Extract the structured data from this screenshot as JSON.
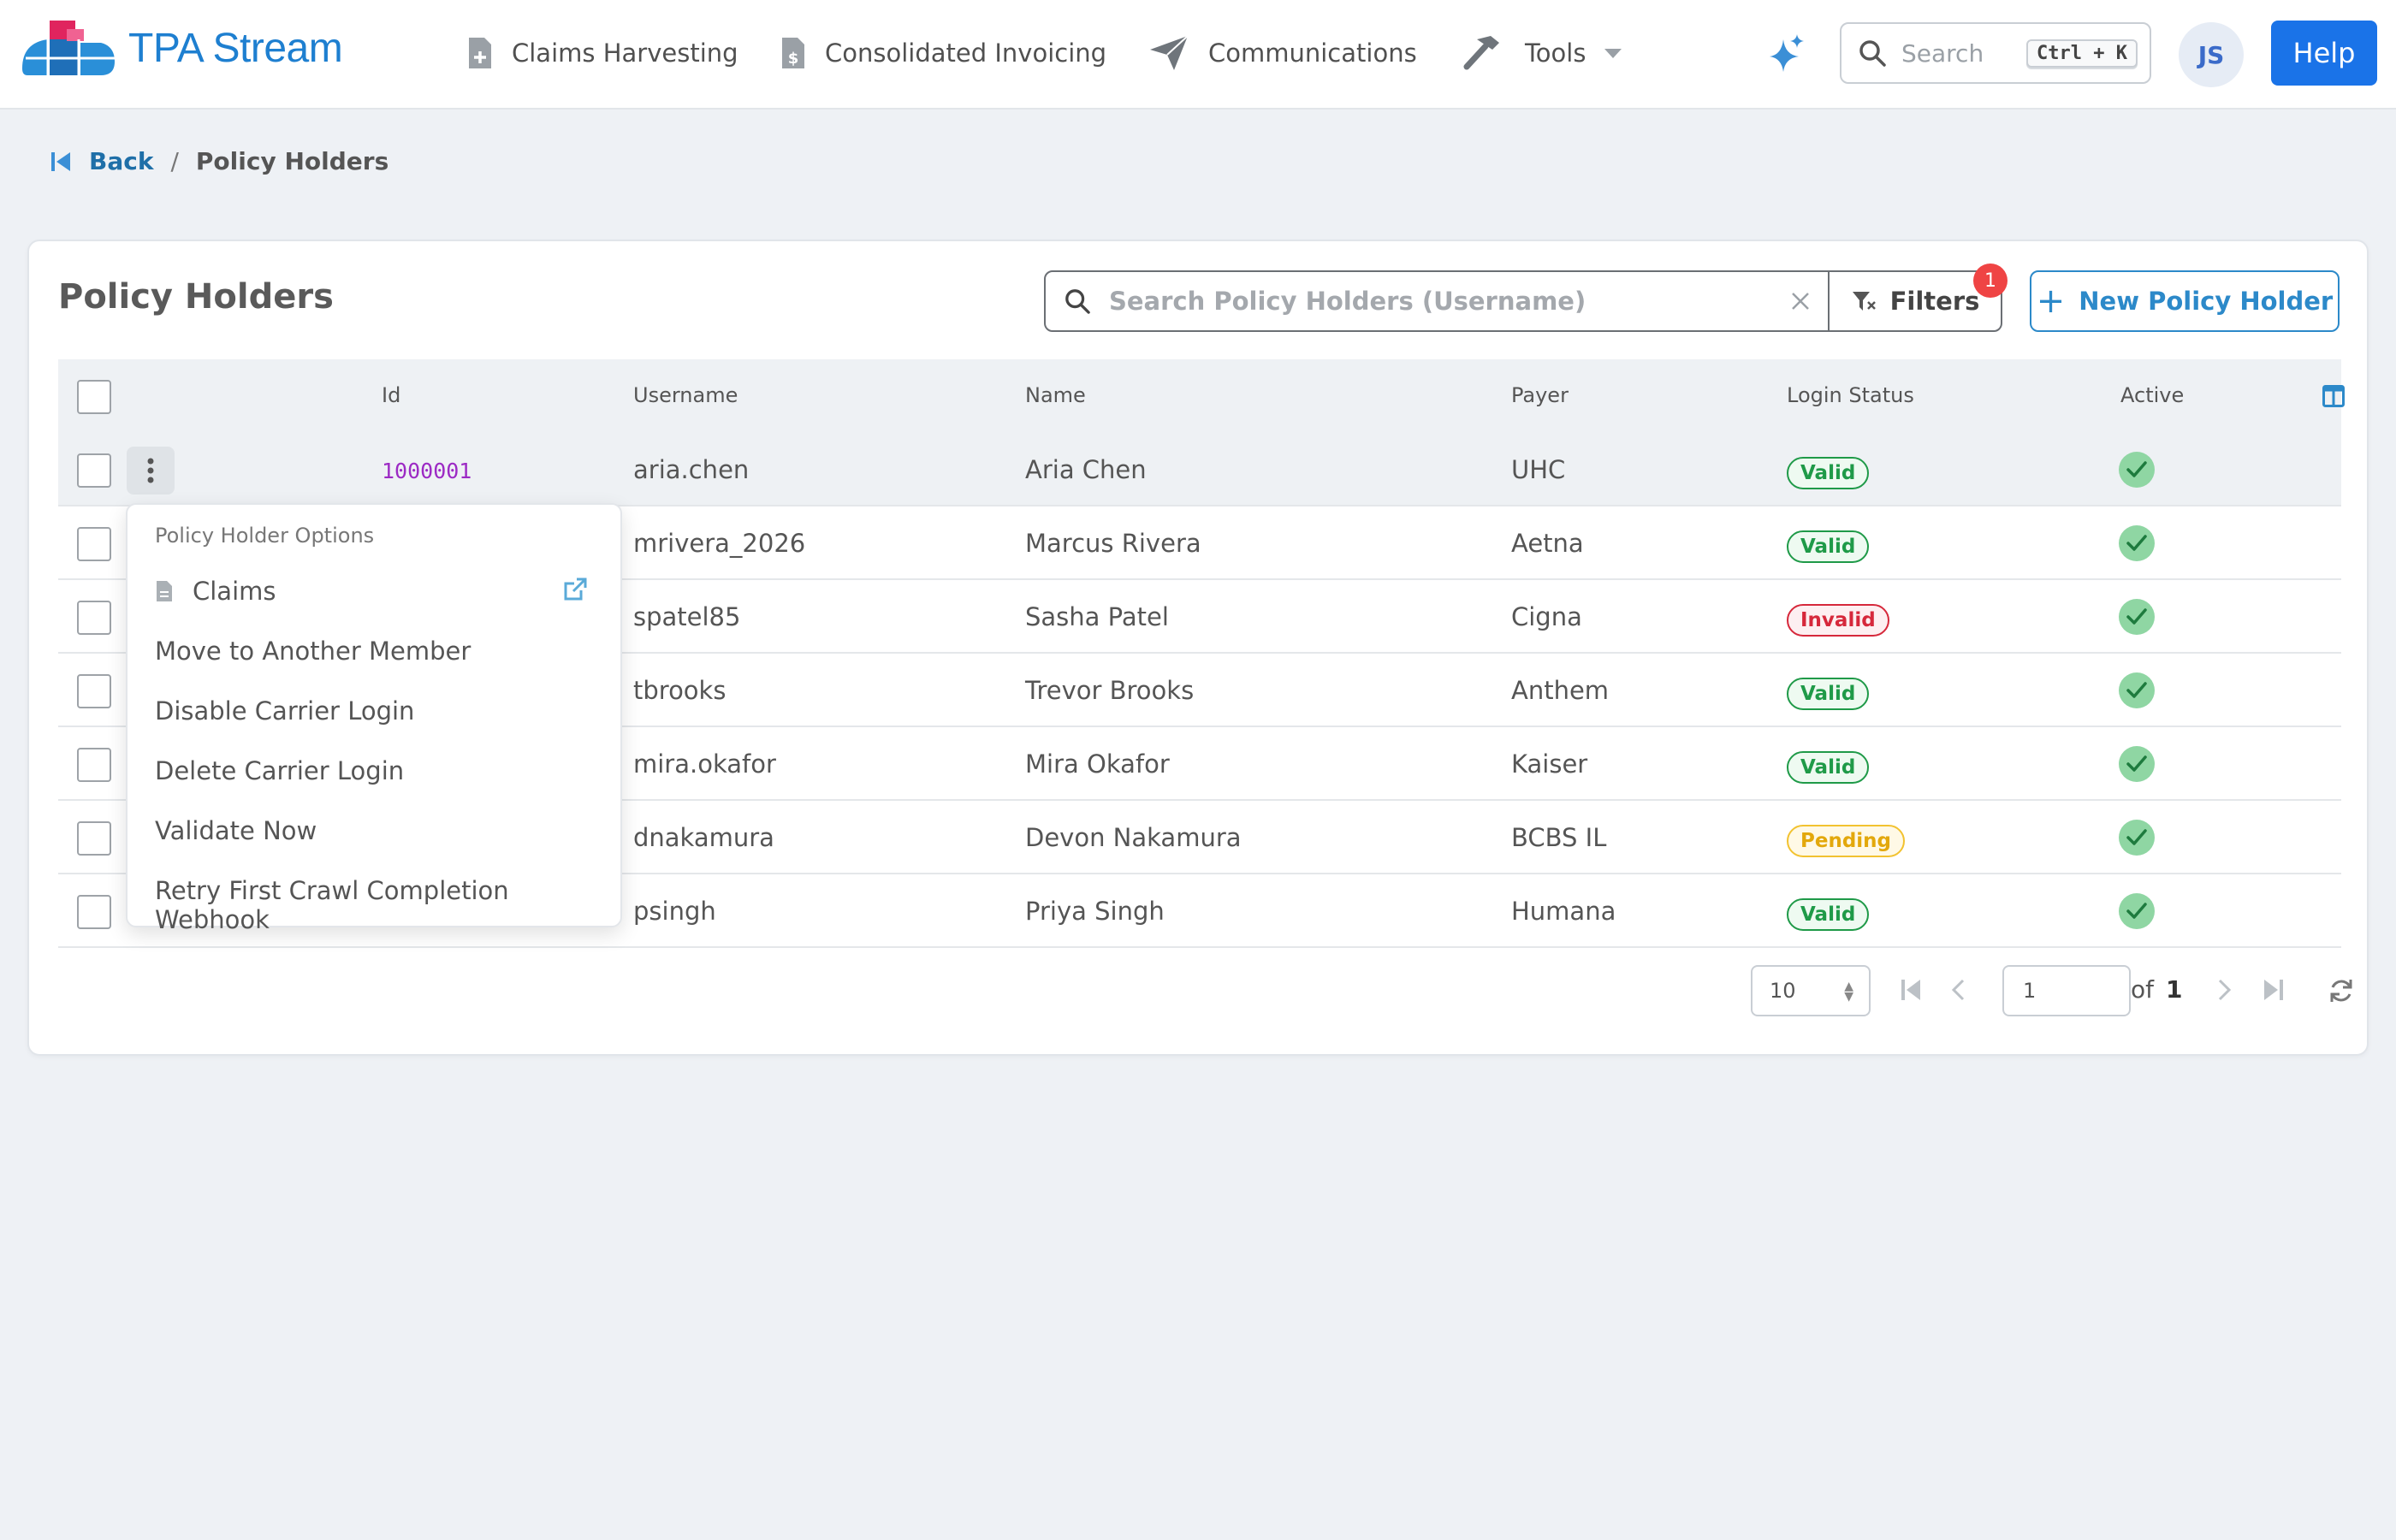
{
  "app": {
    "logo_text": "TPA Stream"
  },
  "nav": {
    "items": [
      {
        "label": "Claims Harvesting",
        "icon": "document-plus-icon"
      },
      {
        "label": "Consolidated Invoicing",
        "icon": "document-dollar-icon"
      },
      {
        "label": "Communications",
        "icon": "paper-plane-icon"
      },
      {
        "label": "Tools",
        "icon": "hammer-icon"
      }
    ],
    "search_placeholder": "Search",
    "search_shortcut": "Ctrl + K",
    "avatar_initials": "JS",
    "help_label": "Help"
  },
  "breadcrumb": {
    "back": "Back",
    "separator": "/",
    "current": "Policy Holders"
  },
  "page": {
    "title": "Policy Holders",
    "search_placeholder": "Search Policy Holders (Username)",
    "filters_label": "Filters",
    "filters_count": "1",
    "new_button": "New Policy Holder"
  },
  "table": {
    "columns": [
      "Id",
      "Username",
      "Name",
      "Payer",
      "Login Status",
      "Active"
    ],
    "rows": [
      {
        "id": "1000001",
        "username": "aria.chen",
        "name": "Aria Chen",
        "payer": "UHC",
        "status": "Valid",
        "active": true
      },
      {
        "id": "",
        "username": "mrivera_2026",
        "name": "Marcus Rivera",
        "payer": "Aetna",
        "status": "Valid",
        "active": true
      },
      {
        "id": "",
        "username": "spatel85",
        "name": "Sasha Patel",
        "payer": "Cigna",
        "status": "Invalid",
        "active": true
      },
      {
        "id": "",
        "username": "tbrooks",
        "name": "Trevor Brooks",
        "payer": "Anthem",
        "status": "Valid",
        "active": true
      },
      {
        "id": "",
        "username": "mira.okafor",
        "name": "Mira Okafor",
        "payer": "Kaiser",
        "status": "Valid",
        "active": true
      },
      {
        "id": "",
        "username": "dnakamura",
        "name": "Devon Nakamura",
        "payer": "BCBS IL",
        "status": "Pending",
        "active": true
      },
      {
        "id": "",
        "username": "psingh",
        "name": "Priya Singh",
        "payer": "Humana",
        "status": "Valid",
        "active": true
      }
    ]
  },
  "row_menu": {
    "header": "Policy Holder Options",
    "items": [
      "Claims",
      "Move to Another Member",
      "Disable Carrier Login",
      "Delete Carrier Login",
      "Validate Now",
      "Retry First Crawl Completion Webhook"
    ]
  },
  "pagination": {
    "page_size": "10",
    "page": "1",
    "of_label": "of",
    "total_pages": "1"
  },
  "colors": {
    "brand_blue": "#1e7fd0",
    "help_blue": "#1a73e8",
    "valid": "#1f9a48",
    "invalid": "#d6283b",
    "pending": "#e3a80c",
    "id_purple": "#9c2ac4"
  }
}
